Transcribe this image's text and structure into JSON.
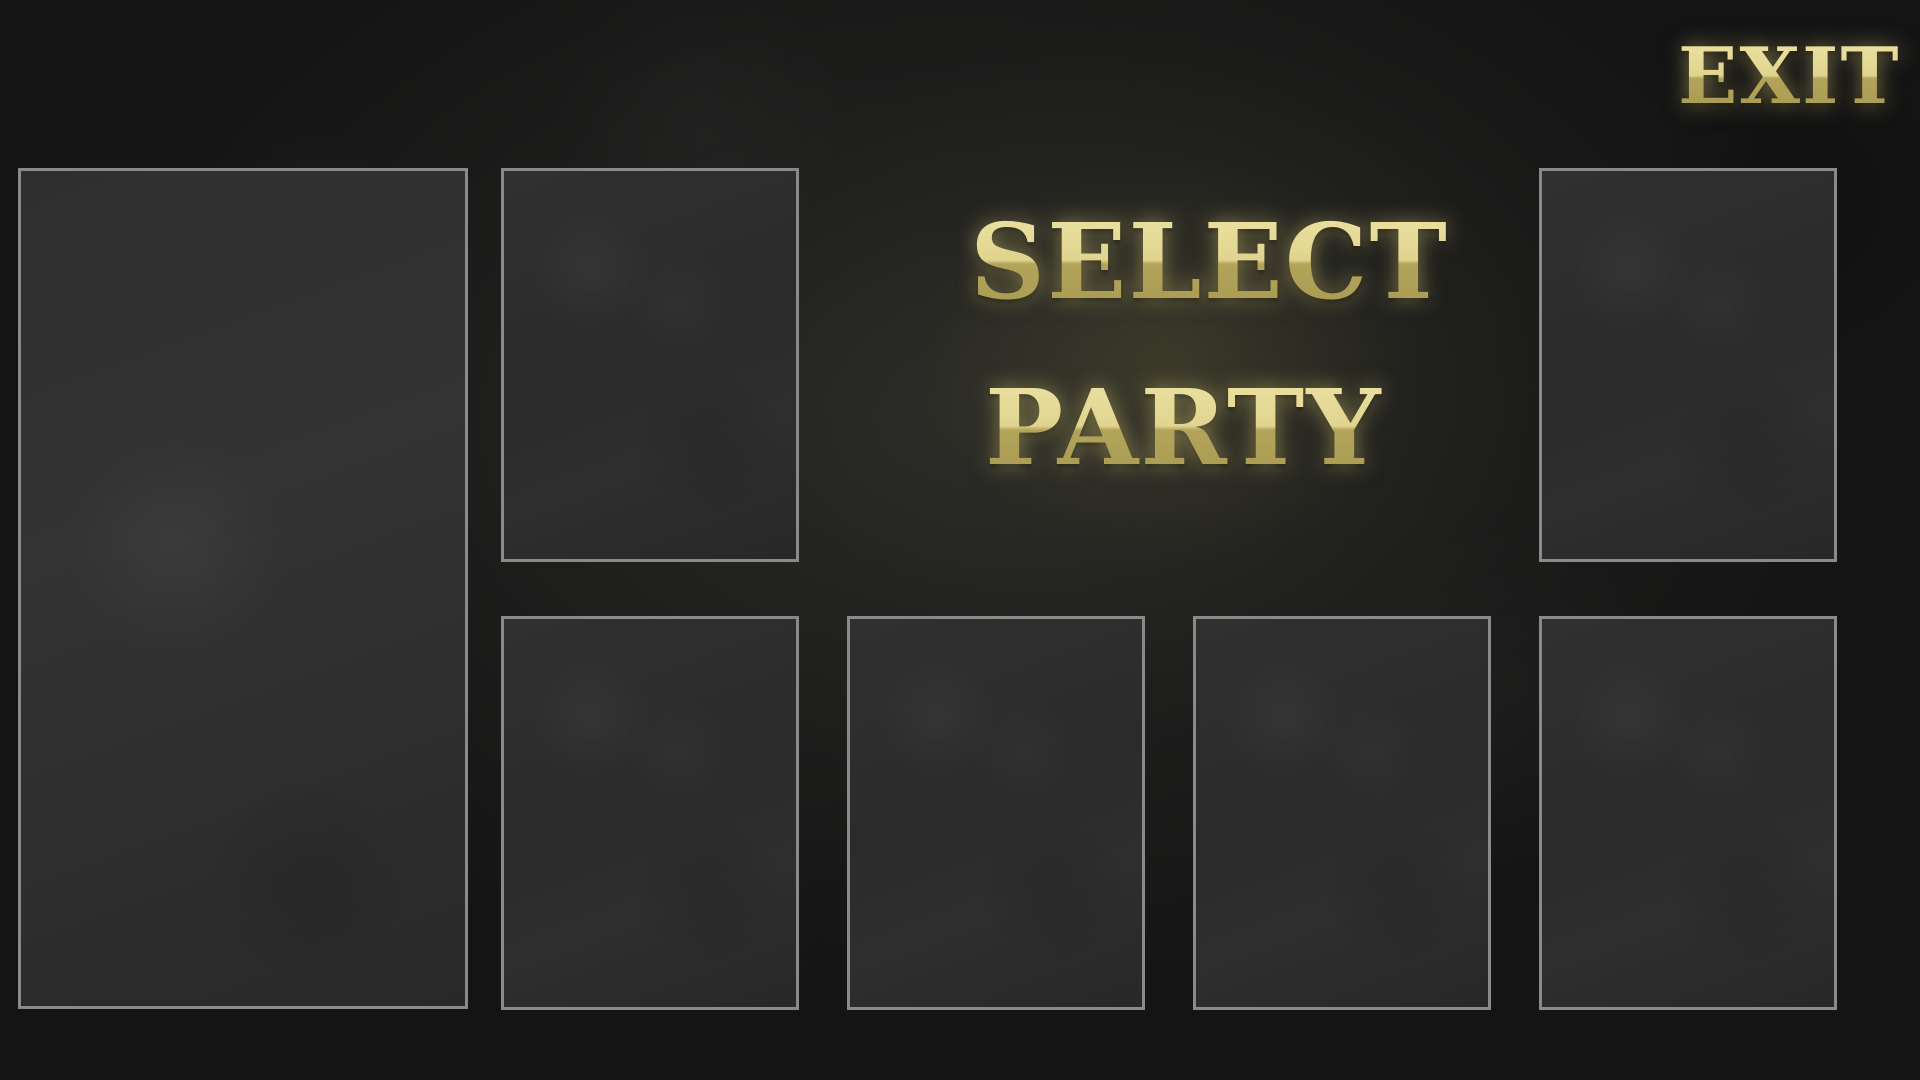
{
  "title": {
    "line1": "SELECT",
    "line2": "PARTY"
  },
  "exit_label": "EXIT",
  "colors": {
    "gold": "#d8cb85",
    "slot_border": "#8a8a8a",
    "background": "#1d1d1c"
  },
  "party_slots": [
    {
      "id": "slot-1",
      "state": "empty",
      "size": "large"
    },
    {
      "id": "slot-2",
      "state": "empty"
    },
    {
      "id": "slot-3",
      "state": "empty"
    },
    {
      "id": "slot-4",
      "state": "empty"
    },
    {
      "id": "slot-5",
      "state": "empty"
    },
    {
      "id": "slot-6",
      "state": "empty"
    },
    {
      "id": "slot-7",
      "state": "empty"
    }
  ]
}
